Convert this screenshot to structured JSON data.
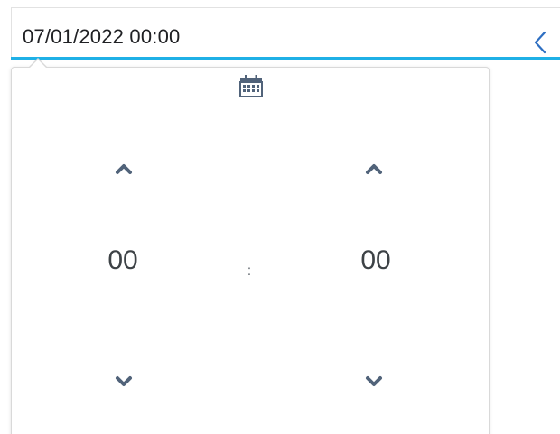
{
  "input": {
    "value": "07/01/2022 00:00"
  },
  "icons": {
    "toggle": "chevron-left-icon",
    "calendar": "calendar-icon",
    "increment": "chevron-up-icon",
    "decrement": "chevron-down-icon"
  },
  "time": {
    "hours": "00",
    "separator": ":",
    "minutes": "00"
  },
  "colors": {
    "accent": "#1fb0e6",
    "icon": "#51637a",
    "text": "#202124"
  }
}
